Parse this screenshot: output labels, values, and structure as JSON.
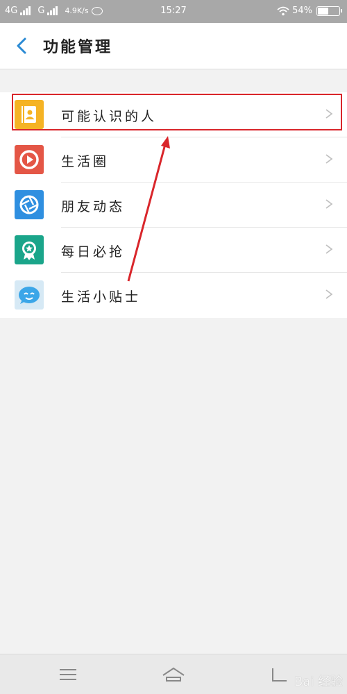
{
  "status_bar": {
    "network1": "4G",
    "network2": "G",
    "speed": "4.9K/s",
    "time": "15:27",
    "battery_text": "54%",
    "battery_level": 0.54
  },
  "header": {
    "title": "功能管理"
  },
  "menu": {
    "items": [
      {
        "label": "可能认识的人",
        "icon": "contact-book-icon",
        "color": "#f5b324"
      },
      {
        "label": "生活圈",
        "icon": "play-circle-icon",
        "color": "#e45646"
      },
      {
        "label": "朋友动态",
        "icon": "aperture-icon",
        "color": "#2f8fe0"
      },
      {
        "label": "每日必抢",
        "icon": "badge-icon",
        "color": "#1aa58a"
      },
      {
        "label": "生活小贴士",
        "icon": "smiley-bubble-icon",
        "color": "#3ba6e8"
      }
    ]
  },
  "watermark": {
    "text": "Bai 经验"
  },
  "colors": {
    "accent": "#2a8ad4",
    "highlight": "#d9262b"
  }
}
